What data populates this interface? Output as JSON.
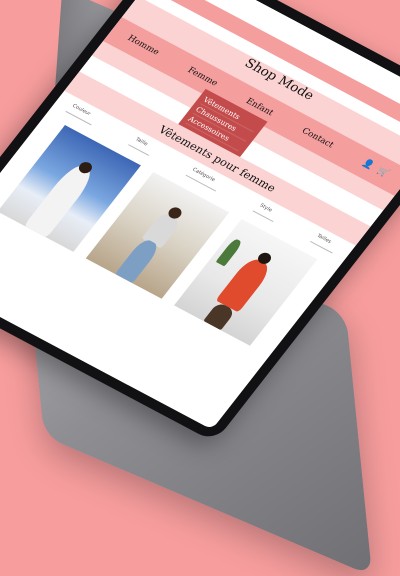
{
  "shop": {
    "logo": "Shop Mode",
    "nav": [
      "Homme",
      "Femme",
      "Enfant",
      "Contact"
    ],
    "icons": [
      "user-icon",
      "cart-icon"
    ],
    "dropdown": [
      "Vêtements",
      "Chaussures",
      "Accessoires"
    ],
    "page_title": "Vêtements pour femme",
    "filters": [
      "Couleur",
      "Taille",
      "Catégorie",
      "Style",
      "Tailles"
    ]
  },
  "colors": {
    "background": "#f79d9d",
    "stripe_pink": "#f59e9e",
    "stripe_light": "#fbd3d3",
    "dropdown": "#c34b4b"
  }
}
